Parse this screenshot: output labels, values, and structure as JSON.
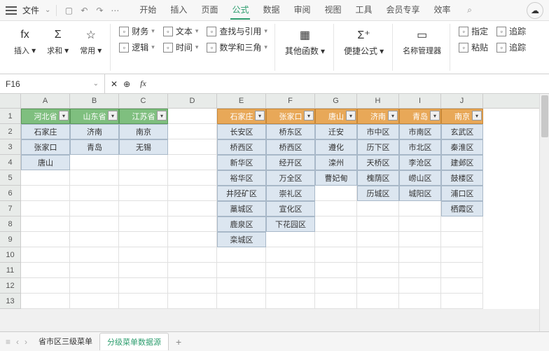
{
  "topbar": {
    "file": "文件",
    "menus": [
      "开始",
      "插入",
      "页面",
      "公式",
      "数据",
      "审阅",
      "视图",
      "工具",
      "会员专享",
      "效率"
    ],
    "active": 3
  },
  "ribbon": {
    "g1": [
      {
        "l": "插入"
      },
      {
        "l": "求和"
      },
      {
        "l": "常用"
      }
    ],
    "g2": [
      [
        "财务",
        "文本",
        "查找与引用"
      ],
      [
        "逻辑",
        "时间",
        "数学和三角"
      ],
      "其他函数"
    ],
    "g3": "便捷公式",
    "g4": "名称管理器",
    "g5": [
      [
        "指定",
        "追踪"
      ],
      [
        "粘贴",
        "追踪"
      ]
    ]
  },
  "fbar": {
    "name": "F16",
    "fx": "fx"
  },
  "cols": [
    "A",
    "B",
    "C",
    "D",
    "E",
    "F",
    "G",
    "H",
    "I",
    "J"
  ],
  "widths": [
    70,
    70,
    70,
    70,
    70,
    70,
    60,
    60,
    60,
    60
  ],
  "rows": 13,
  "activeCell": {
    "r": 16,
    "c": 5
  },
  "headers1": [
    {
      "c": 0,
      "t": "河北省"
    },
    {
      "c": 1,
      "t": "山东省"
    },
    {
      "c": 2,
      "t": "江苏省"
    }
  ],
  "headers2": [
    {
      "c": 4,
      "t": "石家庄"
    },
    {
      "c": 5,
      "t": "张家口"
    },
    {
      "c": 6,
      "t": "唐山"
    },
    {
      "c": 7,
      "t": "济南"
    },
    {
      "c": 8,
      "t": "青岛"
    },
    {
      "c": 9,
      "t": "南京"
    }
  ],
  "data": {
    "0": [
      null,
      "石家庄",
      "张家口",
      "唐山"
    ],
    "1": [
      null,
      "济南",
      "青岛"
    ],
    "2": [
      null,
      "南京",
      "无锡"
    ],
    "4": [
      null,
      "长安区",
      "桥西区",
      "新华区",
      "裕华区",
      "井陉矿区",
      "藁城区",
      "鹿泉区",
      "栾城区"
    ],
    "5": [
      null,
      "桥东区",
      "桥西区",
      "经开区",
      "万全区",
      "崇礼区",
      "宣化区",
      "下花园区"
    ],
    "6": [
      null,
      "迁安",
      "遵化",
      "滦州",
      "曹妃甸"
    ],
    "7": [
      null,
      "市中区",
      "历下区",
      "天桥区",
      "槐荫区",
      "历城区"
    ],
    "8": [
      null,
      "市南区",
      "市北区",
      "李沧区",
      "崂山区",
      "城阳区"
    ],
    "9": [
      null,
      "玄武区",
      "秦淮区",
      "建邺区",
      "鼓楼区",
      "浦口区",
      "栖霞区"
    ]
  },
  "sheets": {
    "items": [
      "省市区三级菜单",
      "分级菜单数据源"
    ],
    "active": 1
  }
}
